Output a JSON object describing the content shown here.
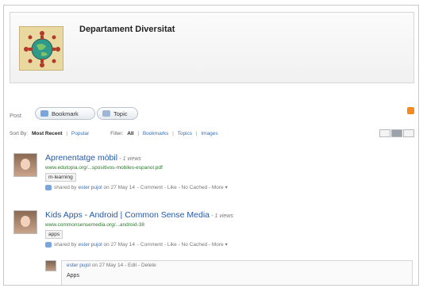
{
  "group": {
    "title": "Departament Diversitat"
  },
  "post_bar": {
    "label": "Post",
    "bookmark_label": "Bookmark",
    "topic_label": "Topic"
  },
  "sort": {
    "label": "Sort By:",
    "most_recent": "Most Recent",
    "sep": "|",
    "popular": "Popular",
    "filter_label": "Filter:",
    "all": "All",
    "bookmarks": "Bookmarks",
    "topics": "Topics",
    "images": "Images"
  },
  "items": [
    {
      "title": "Aprenentatge mòbil",
      "views": "- 1 views",
      "url": "www.edutopia.org/...spositivos-mobiles-espanol.pdf",
      "tag": "m-learning",
      "shared_by_label": "shared by",
      "user": "ester pujol",
      "date": "on 27 May 14",
      "actions": "- Comment - Like - No Cached - More ▾"
    },
    {
      "title": "Kids Apps - Android | Common Sense Media",
      "views": "- 1 views",
      "url": "www.commonsensemedia.org/...android-38",
      "tag": "apps",
      "shared_by_label": "shared by",
      "user": "ester pujol",
      "date": "on 27 May 14",
      "actions": "- Comment - Like - No Cached - More ▾"
    }
  ],
  "comment": {
    "user": "ester pujol",
    "date": "on 27 May 14",
    "actions": "- Edit - Delete",
    "text": "Apps"
  },
  "icons": {
    "rss": "rss-feed-icon",
    "views": [
      "list-view-icon",
      "detail-view-icon",
      "thumb-view-icon"
    ]
  },
  "colors": {
    "link": "#2559a7",
    "url": "#2c7a2c",
    "rss": "#f28a1e"
  }
}
